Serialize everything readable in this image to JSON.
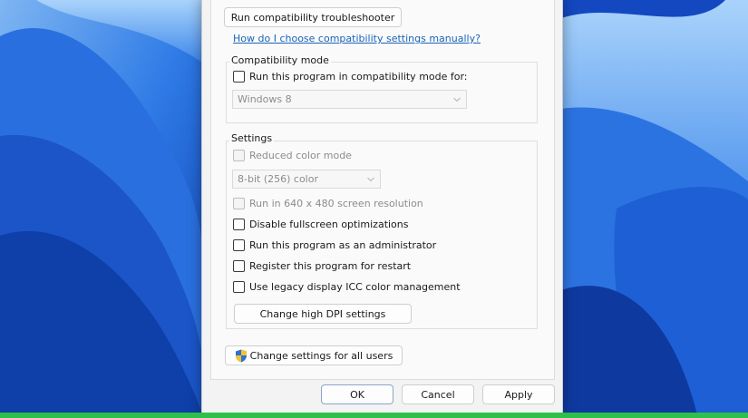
{
  "troubleshooter_button": "Run compatibility troubleshooter",
  "help_link": "How do I choose compatibility settings manually?",
  "compatibility_mode": {
    "title": "Compatibility mode",
    "checkbox_label": "Run this program in compatibility mode for:",
    "os_select_value": "Windows 8"
  },
  "settings": {
    "title": "Settings",
    "reduced_color_label": "Reduced color mode",
    "color_select_value": "8-bit (256) color",
    "resolution_label": "Run in 640 x 480 screen resolution",
    "fullscreen_label": "Disable fullscreen optimizations",
    "admin_label": "Run this program as an administrator",
    "restart_label": "Register this program for restart",
    "icc_label": "Use legacy display ICC color management",
    "dpi_button": "Change high DPI settings"
  },
  "all_users_button": "Change settings for all users",
  "footer": {
    "ok": "OK",
    "cancel": "Cancel",
    "apply": "Apply"
  },
  "colors": {
    "wallpaper_blue": "#1f5fd6",
    "link": "#1a64b8",
    "shield_blue": "#2b6fd8",
    "shield_yellow": "#f2c230"
  }
}
